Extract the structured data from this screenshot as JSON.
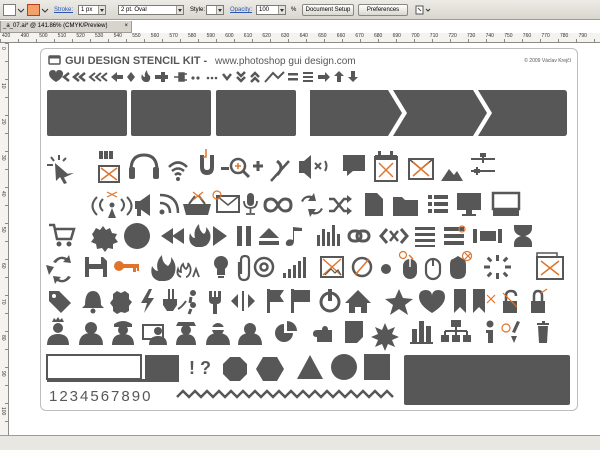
{
  "toolbar": {
    "stroke_label": "Stroke:",
    "stroke_weight": "1 px",
    "brush": "2 pt. Oval",
    "style_label": "Style:",
    "opacity_label": "Opacity:",
    "opacity_value": "100",
    "percent_sign": "%",
    "document_setup": "Document Setup",
    "preferences": "Preferences"
  },
  "document_tab": {
    "title": "_a_07.ai* @ 141.86% (CMYK/Preview)",
    "close": "×"
  },
  "ruler": {
    "horizontal": [
      "420",
      "490",
      "500",
      "510",
      "520",
      "530",
      "540",
      "550",
      "560",
      "570",
      "580",
      "590",
      "600",
      "610",
      "620",
      "630",
      "640",
      "650",
      "660",
      "670",
      "680",
      "690",
      "700",
      "710",
      "720",
      "730",
      "740",
      "750",
      "760",
      "770",
      "780",
      "790"
    ],
    "vertical": [
      "0",
      "10",
      "20",
      "30",
      "40",
      "50",
      "60",
      "70",
      "80",
      "90",
      "100"
    ]
  },
  "kit": {
    "title": "GUI DESIGN STENCIL KIT -",
    "url": "www.photoshop gui design.com",
    "copyright": "© 2009 Václav Krejčí",
    "numbers": "1234567890",
    "punctuation": "! ?"
  },
  "colors": {
    "icon": "#575757",
    "accent": "#e0742a",
    "toolbar_bg": "#dedcd5"
  },
  "icons": {
    "row1": [
      "heart-icon",
      "chevron-left-icon",
      "double-chevron-left-icon",
      "triple-chevron-left-icon",
      "arrow-left-icon",
      "diamond-icon",
      "flame-icon",
      "power-plug-icon",
      "plug-icon",
      "dots-icon",
      "ellipsis-icon",
      "chevron-down-icon",
      "double-chevron-down-icon",
      "double-chevron-up-icon",
      "slash-icon",
      "equals-icon",
      "triple-bar-icon",
      "arrow-right-icon",
      "arrow-up-icon",
      "arrow-down-icon"
    ],
    "row3": [
      "cursor-click-icon",
      "battery-icon",
      "headphones-icon",
      "wifi-icon",
      "magnet-icon",
      "zoom-out-icon",
      "zoom-in-icon",
      "mute-icon",
      "volume-off-icon",
      "speech-bubble-icon",
      "calendar-icon",
      "envelope-cross-icon",
      "mountain-icon",
      "slider-icon"
    ],
    "row4": [
      "wireless-icon",
      "broadcast-icon",
      "megaphone-icon",
      "rss-icon",
      "basket-icon",
      "mail-icon",
      "microphone-icon",
      "infinity-icon",
      "refresh-icon",
      "shuffle-icon",
      "document-icon",
      "folder-icon",
      "list-icon",
      "monitor-icon",
      "display-icon"
    ],
    "row5": [
      "cart-icon",
      "gear-icon",
      "circle-icon",
      "rewind-icon",
      "fire-icon",
      "play-icon",
      "pause-icon",
      "eject-icon",
      "music-icon",
      "equalizer-icon",
      "link-icon",
      "code-icon",
      "menu-icon",
      "bars-icon",
      "slider-h-icon",
      "hourglass-icon"
    ],
    "row6": [
      "recycle-icon",
      "save-icon",
      "key-icon",
      "flame-icon",
      "trophy-icon",
      "bulb-icon",
      "attachment-icon",
      "at-sign-icon",
      "signal-icon",
      "picture-cross-icon",
      "power-cross-icon",
      "dot-icon",
      "mouse-icon",
      "mouse-alt-icon",
      "bug-icon",
      "loading-icon",
      "image-icon"
    ],
    "row7": [
      "tag-icon",
      "bell-icon",
      "badge-icon",
      "lightning-icon",
      "ticket-icon",
      "quote-icon",
      "wrench-icon",
      "resize-icon",
      "flag-icon",
      "flag-alt-icon",
      "power-icon",
      "home-icon",
      "star-icon",
      "heart-icon",
      "bookmark-icon",
      "bookmark-cross-icon",
      "lock-open-icon",
      "lock-icon"
    ],
    "row8": [
      "person-crown-icon",
      "person-icon",
      "person-hat-icon",
      "person-board-icon",
      "person-cap-icon",
      "person-glasses-icon",
      "person-icon",
      "pie-chart-icon",
      "puzzle-icon",
      "sticky-note-icon",
      "cog-flower-icon",
      "bar-chart-icon",
      "sitemap-icon",
      "info-icon",
      "trash-icon"
    ]
  }
}
